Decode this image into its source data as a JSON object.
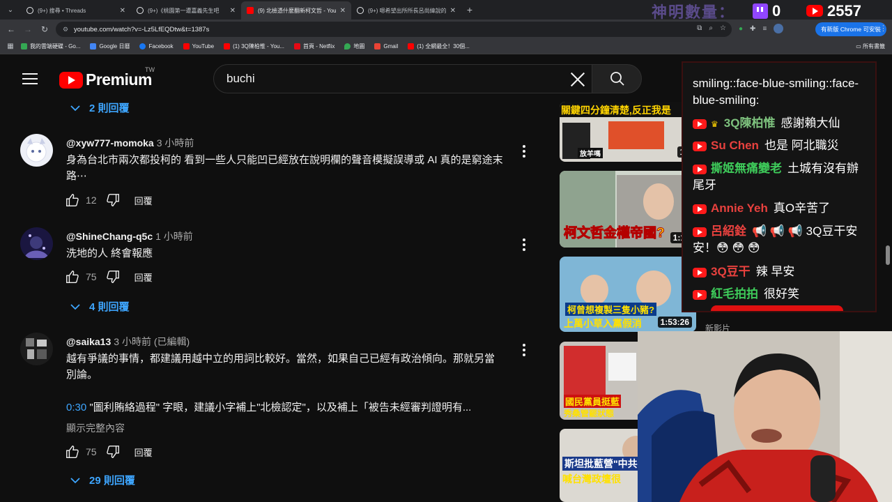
{
  "browser": {
    "tabs": [
      {
        "title": "(9+) 搜尋 • Threads",
        "favicon_color": "#e8eaed",
        "active": false
      },
      {
        "title": "(9+)《桃園第一遭嘉義先生吧",
        "favicon_color": "#e8eaed",
        "active": false
      },
      {
        "title": "(9) 北檢憑什麼翻新柯文哲 - YouTube",
        "favicon_color": "#ff0000",
        "active": true
      },
      {
        "title": "(9+) 嗯希望出所所長呂尚緯說的",
        "favicon_color": "#e8eaed",
        "active": false
      }
    ],
    "url": "youtube.com/watch?v=-Lz5LfEQDtw&t=1387s",
    "update_button": "有新版 Chrome 可安裝",
    "bookmarks": [
      {
        "label": "我的雲端硬碟 - Go...",
        "color": "#34a853"
      },
      {
        "label": "Google 日曆",
        "color": "#4285f4"
      },
      {
        "label": "Facebook",
        "color": "#1877f2"
      },
      {
        "label": "YouTube",
        "color": "#ff0000"
      },
      {
        "label": "(1) 3Q陳柏惟 - You...",
        "color": "#ff0000"
      },
      {
        "label": "首頁 - Netflix",
        "color": "#e50914"
      },
      {
        "label": "地圖",
        "color": "#34a853"
      },
      {
        "label": "Gmail",
        "color": "#ea4335"
      },
      {
        "label": "(1) 全網最全！30個...",
        "color": "#ff0000"
      }
    ],
    "all_bookmarks": "所有書籤"
  },
  "header": {
    "logo_text": "Premium",
    "region": "TW",
    "search_value": "buchi"
  },
  "comments": {
    "replies_top": "2 則回覆",
    "list": [
      {
        "user": "@xyw777-momoka",
        "time": "3 小時前",
        "text": "身為台北市兩次都投柯的 看到一些人只能凹已經放在說明欄的聲音模擬誤導或 AI 真的是窮途末路⋯",
        "likes": "12",
        "reply_label": "回覆"
      },
      {
        "user": "@ShineChang-q5c",
        "time": "1 小時前",
        "text": "洗地的人 終會報應",
        "likes": "75",
        "reply_label": "回覆",
        "replies": "4 則回覆"
      },
      {
        "user": "@saika13",
        "time": "3 小時前 (已編輯)",
        "text": "越有爭議的事情，都建議用越中立的用詞比較好。當然，如果自己已經有政治傾向。那就另當別論。",
        "timestamp": "0:30",
        "text2": " \"圖利賄絡過程\" 字眼，建議小字補上\"北檢認定\"，以及補上「被告未經審判證明有...",
        "show_more": "顯示完整內容",
        "likes": "75",
        "reply_label": "回覆",
        "replies": "29 則回覆"
      }
    ]
  },
  "related": [
    {
      "caption": "關鍵四分鐘清楚,反正我是",
      "sub": "放羊嗎",
      "duration": "16"
    },
    {
      "caption": "柯文哲金權帝國?",
      "duration": "1:11"
    },
    {
      "caption": "柯曾想複製三隻小豬?",
      "sub": "上萬小草入黨假消",
      "duration": "1:53:26"
    },
    {
      "caption": "國民黨員挺藍",
      "sub": "秀桑管罷狀態",
      "duration": ""
    },
    {
      "caption": "斯坦批藍營\"中共",
      "sub": "喊台灣政壇很",
      "duration": ""
    }
  ],
  "new_videos_label": "新影片",
  "stream_overlay": {
    "label": "神明數量：",
    "twitch_count": "0",
    "youtube_count": "2557"
  },
  "chat": [
    {
      "name": "",
      "text": "smiling::face-blue-smiling::face-blue-smiling:",
      "name_color": "#ffffff"
    },
    {
      "name": "3Q陳柏惟",
      "text": "感謝賴大仙",
      "name_color": "#7ec27e"
    },
    {
      "name": "Su Chen",
      "text": "也是 阿北職災",
      "name_color": "#e8413e"
    },
    {
      "name": "撕姬無痛變老",
      "text": "土城有沒有辦尾牙",
      "name_color": "#3ecb5a"
    },
    {
      "name": "Annie Yeh",
      "text": "真O辛苦了",
      "name_color": "#e8413e"
    },
    {
      "name": "呂紹銓",
      "text": "📢 📢 📢 3Q豆干安安！😳 😳 😳",
      "name_color": "#e8413e"
    },
    {
      "name": "3Q豆干",
      "text": "辣 早安",
      "name_color": "#e8413e"
    },
    {
      "name": "紅毛拍拍",
      "text": "很好笑",
      "name_color": "#3ecb5a"
    }
  ]
}
